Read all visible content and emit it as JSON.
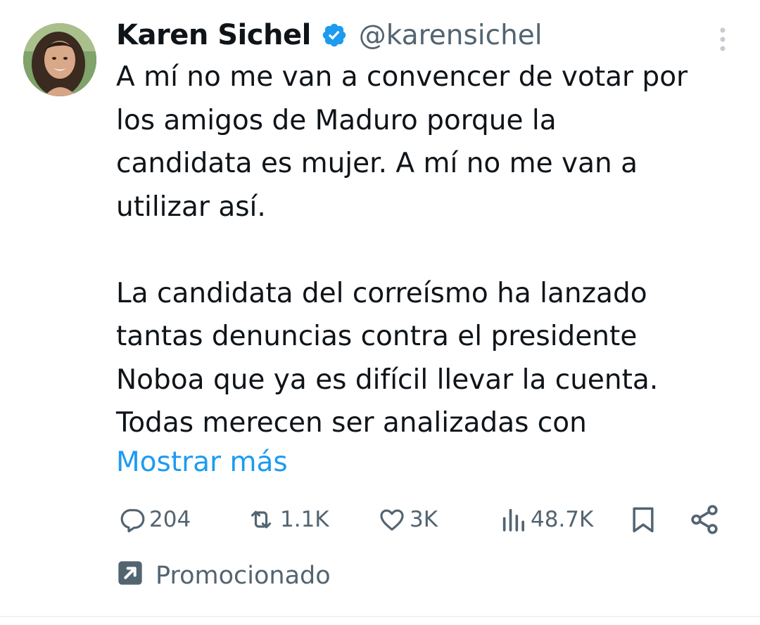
{
  "author": {
    "name": "Karen Sichel",
    "handle": "@karensichel",
    "verified": true,
    "verified_color": "#1d9bf0"
  },
  "tweet": {
    "paragraphs": [
      [
        "A mí no me van a convencer de votar por",
        "los amigos de Maduro porque la",
        "candidata es mujer. A mí no me van a",
        "utilizar así."
      ],
      [
        "La candidata del correísmo ha lanzado",
        "tantas denuncias contra el presidente",
        "Noboa que ya es difícil llevar la cuenta.",
        "Todas merecen ser analizadas con"
      ]
    ],
    "show_more_label": "Mostrar más",
    "link_color": "#1d9bf0"
  },
  "actions": {
    "reply": {
      "icon": "reply-icon",
      "count": "204"
    },
    "retweet": {
      "icon": "retweet-icon",
      "count": "1.1K"
    },
    "like": {
      "icon": "heart-icon",
      "count": "3K"
    },
    "views": {
      "icon": "views-icon",
      "count": "48.7K"
    },
    "bookmark": {
      "icon": "bookmark-icon"
    },
    "share": {
      "icon": "share-icon"
    }
  },
  "promoted": {
    "icon": "promoted-arrow-icon",
    "label": "Promocionado"
  },
  "colors": {
    "text": "#0f1419",
    "secondary": "#536471",
    "accent": "#1d9bf0"
  }
}
